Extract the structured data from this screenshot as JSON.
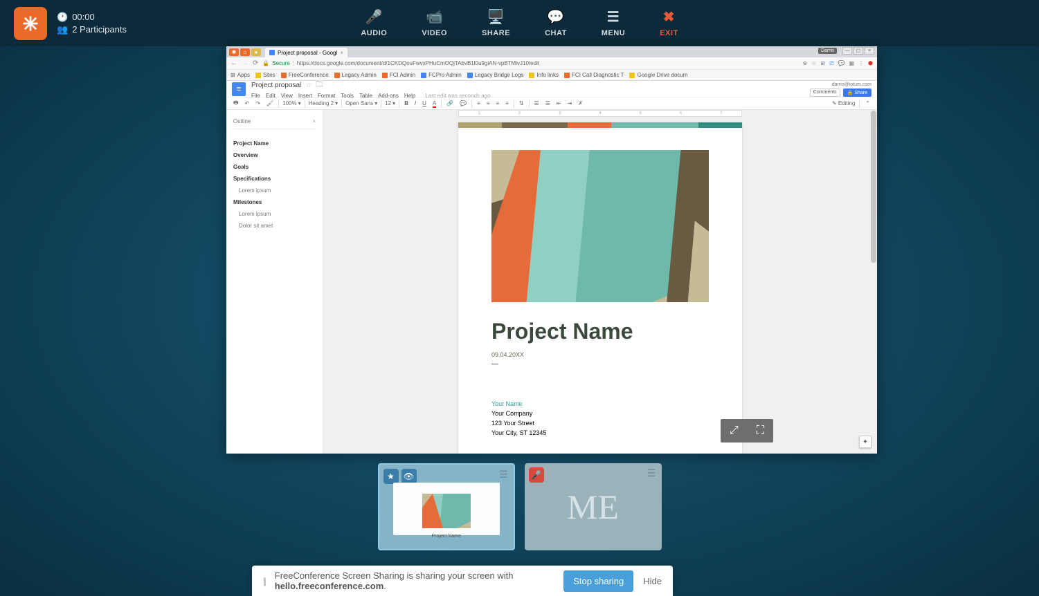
{
  "topbar": {
    "timer": "00:00",
    "participants": "2 Participants",
    "controls": {
      "audio": "AUDIO",
      "video": "VIDEO",
      "share": "SHARE",
      "chat": "CHAT",
      "menu": "MENU",
      "exit": "EXIT"
    }
  },
  "browser": {
    "tab_title": "Project proposal - Googl",
    "user_badge": "Darrin",
    "url_secure": "Secure",
    "url": "https://docs.google.com/document/d/1CKDQouFwvxPHuCmOQjTAbvB1l0u9giAN-vpBTMivJ10/edit",
    "bookmarks": [
      "Apps",
      "Sites",
      "FreeConference",
      "Legacy Admin",
      "FCI Admin",
      "FCPro Admin",
      "Legacy Bridge Logs",
      "Info links",
      "FCI Call Diagnostic T",
      "Google Drive docum"
    ]
  },
  "docs": {
    "title": "Project proposal",
    "menus": [
      "File",
      "Edit",
      "View",
      "Insert",
      "Format",
      "Tools",
      "Table",
      "Add-ons",
      "Help"
    ],
    "last_edit": "Last edit was seconds ago",
    "email": "darrin@iotum.com",
    "comments_btn": "Comments",
    "share_btn": "Share",
    "zoom": "100%",
    "heading": "Heading 2",
    "font": "Open Sans",
    "fontsize": "12",
    "editing": "Editing"
  },
  "outline": {
    "title": "Outline",
    "items": [
      {
        "label": "Project Name",
        "bold": true
      },
      {
        "label": "Overview",
        "bold": true
      },
      {
        "label": "Goals",
        "bold": true
      },
      {
        "label": "Specifications",
        "bold": true
      },
      {
        "label": "Lorem ipsum",
        "sub": true
      },
      {
        "label": "Milestones",
        "bold": true
      },
      {
        "label": "Lorem ipsum",
        "sub": true
      },
      {
        "label": "Dolor sit amet",
        "sub": true
      }
    ]
  },
  "document": {
    "title": "Project Name",
    "date": "09.04.20XX",
    "your_name": "Your Name",
    "company": "Your Company",
    "street": "123 Your Street",
    "city": "Your City, ST 12345"
  },
  "thumbs": {
    "presenter_title": "Project Name",
    "me_label": "ME"
  },
  "sharebar": {
    "text_prefix": "FreeConference Screen Sharing is sharing your screen with ",
    "text_host": "hello.freeconference.com",
    "text_suffix": ".",
    "stop": "Stop sharing",
    "hide": "Hide"
  }
}
